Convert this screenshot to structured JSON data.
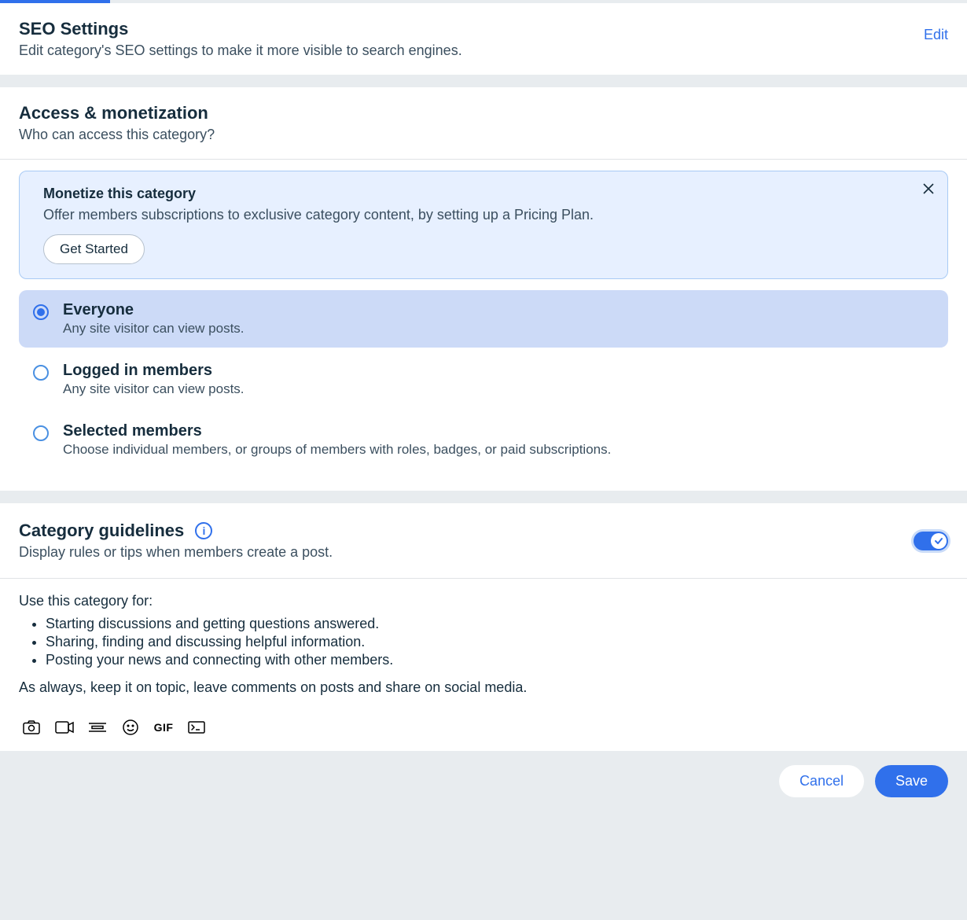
{
  "seo": {
    "title": "SEO Settings",
    "subtitle": "Edit category's SEO settings to make it more visible to search engines.",
    "edit": "Edit"
  },
  "access": {
    "title": "Access & monetization",
    "subtitle": "Who can access this category?",
    "notice": {
      "title": "Monetize this category",
      "text": "Offer members subscriptions to exclusive category content, by setting up a Pricing Plan.",
      "button": "Get Started"
    },
    "options": [
      {
        "label": "Everyone",
        "desc": "Any site visitor can view posts.",
        "selected": true
      },
      {
        "label": "Logged in members",
        "desc": "Any site visitor can view posts.",
        "selected": false
      },
      {
        "label": "Selected members",
        "desc": "Choose individual members, or groups of members with roles, badges, or paid subscriptions.",
        "selected": false
      }
    ]
  },
  "guidelines": {
    "title": "Category guidelines",
    "subtitle": "Display rules or tips when members create a post.",
    "toggle_on": true,
    "intro": "Use this category for:",
    "bullets": [
      "Starting discussions and getting questions answered.",
      "Sharing, finding and discussing helpful information.",
      "Posting your news and connecting with other members."
    ],
    "outro": "As always, keep it on topic, leave comments on posts and share on social media."
  },
  "toolbar": {
    "gif": "GIF"
  },
  "footer": {
    "cancel": "Cancel",
    "save": "Save"
  }
}
